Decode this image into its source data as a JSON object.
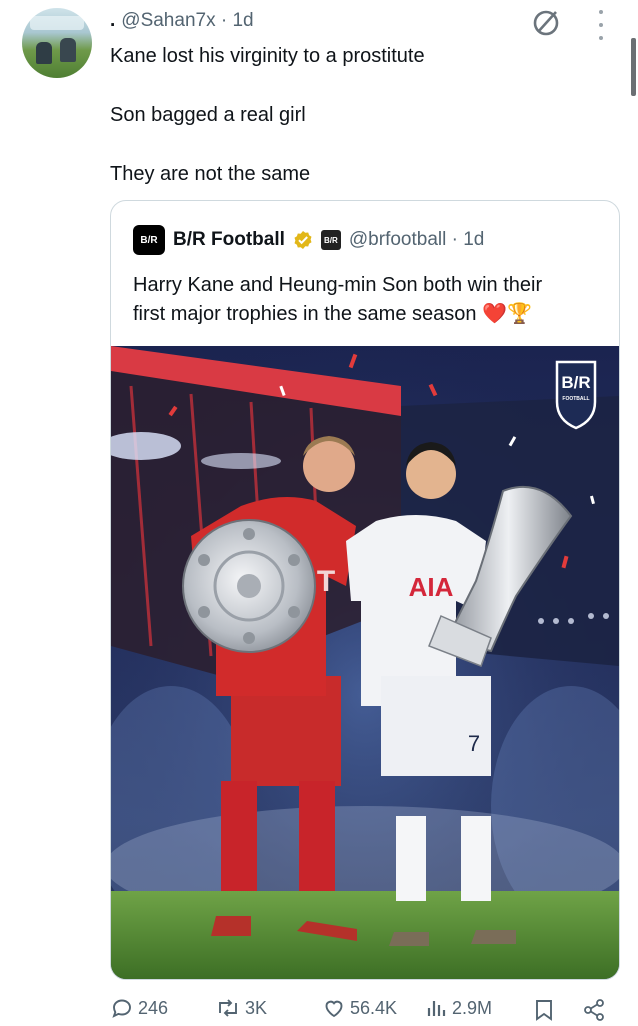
{
  "post": {
    "separator": ".",
    "handle_time": "@Sahan7x · 1d",
    "lines": [
      "Kane lost his virginity to a prostitute",
      "Son bagged a real girl",
      "They are not the same"
    ]
  },
  "quoted": {
    "logo_text": "B/R",
    "name": "B/R Football",
    "handle_time": "@brfootball · 1d",
    "text_line1": "Harry Kane and Heung-min Son both win their",
    "text_line2": "first major trophies in the same season",
    "emojis": "❤️🏆",
    "image": {
      "watermark": "B/R",
      "watermark_sub": "FOOTBALL",
      "shirt_sponsor_left": "T",
      "shirt_sponsor_right": "AIA",
      "shirt_number": "7"
    }
  },
  "actions": {
    "replies": "246",
    "reposts": "3K",
    "likes": "56.4K",
    "views": "2.9M"
  },
  "colors": {
    "text": "#0f1419",
    "muted": "#536471",
    "border": "#cfd9de",
    "verified_gold": "#e2b719",
    "heart": "#d92b3a"
  },
  "icons": [
    "no-entry-icon",
    "more-vertical-icon",
    "verified-badge-icon",
    "reply-icon",
    "repost-icon",
    "like-icon",
    "views-icon",
    "bookmark-icon",
    "share-icon"
  ]
}
